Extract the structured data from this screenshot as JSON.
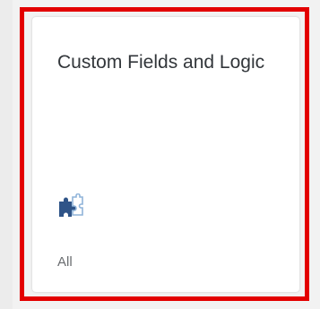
{
  "tile": {
    "title": "Custom Fields and Logic",
    "icon": "puzzle-piece-icon",
    "footer": "All"
  },
  "colors": {
    "highlight_border": "#e30000",
    "icon_primary": "#2f5488",
    "icon_secondary": "#8fb3d9"
  }
}
